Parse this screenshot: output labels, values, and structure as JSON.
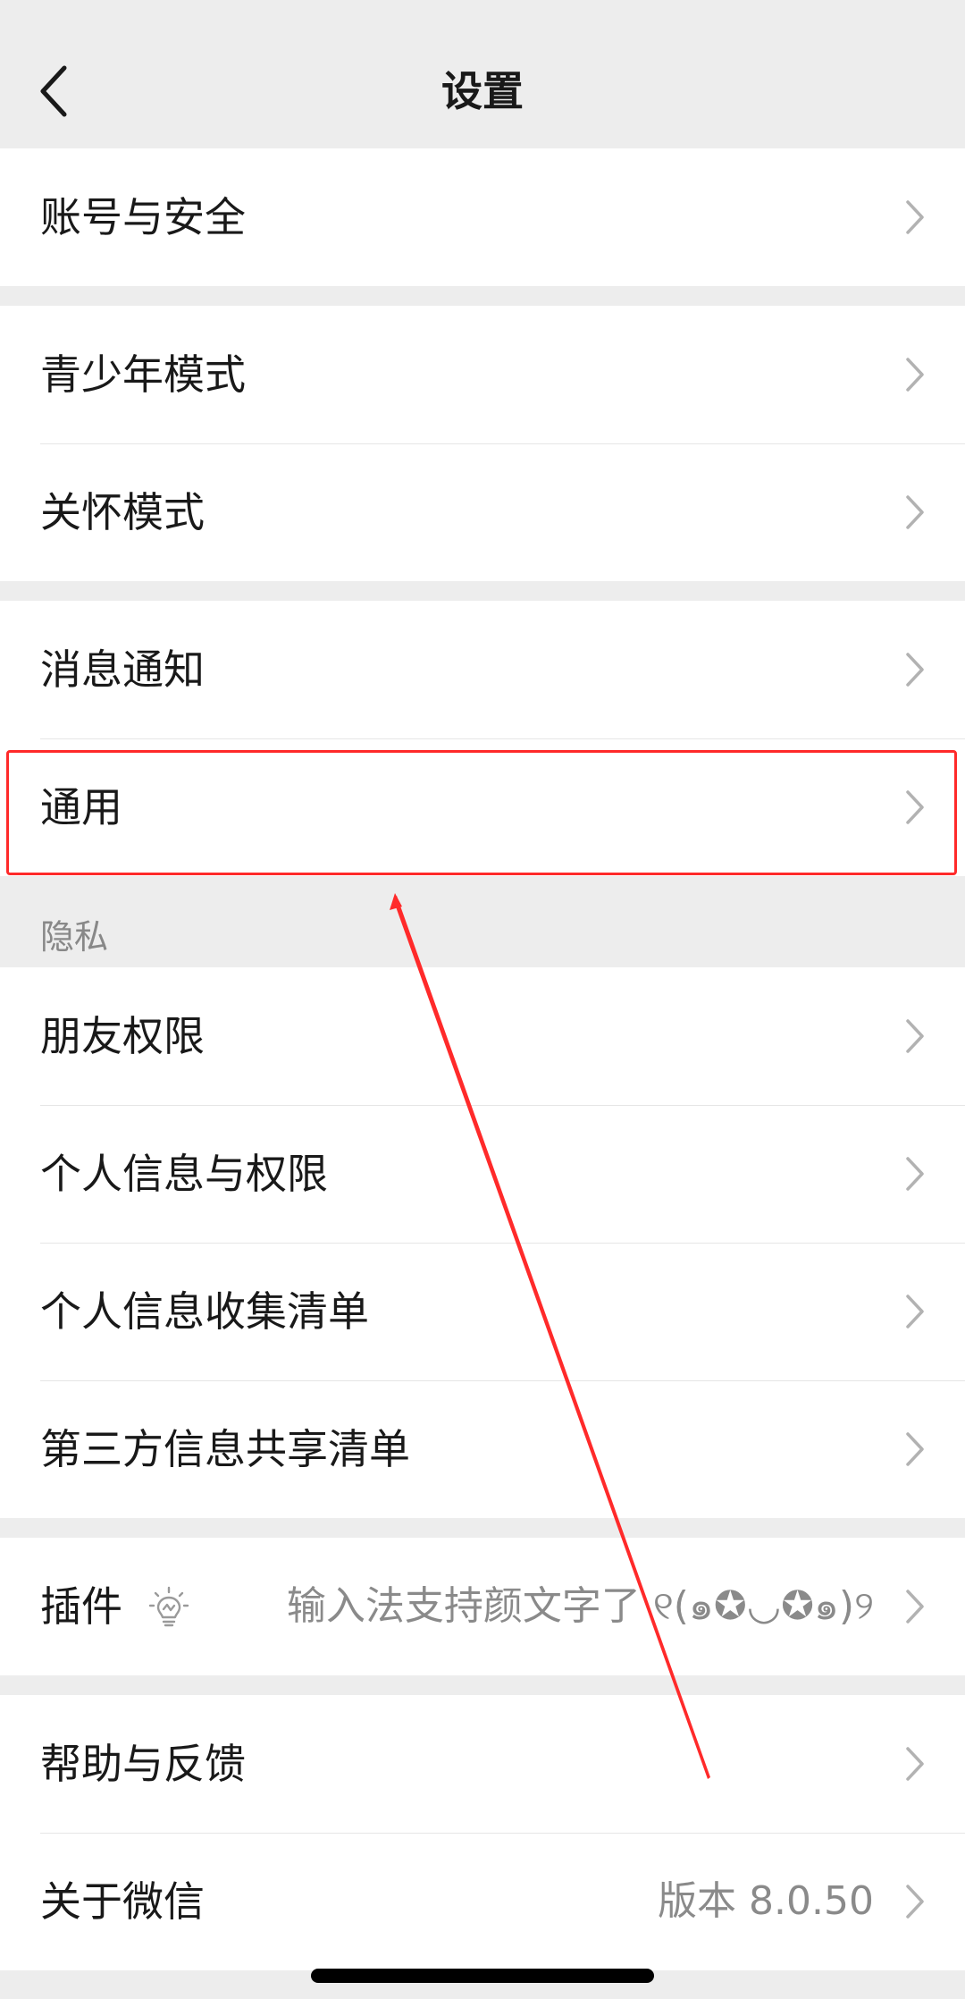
{
  "header": {
    "title": "设置",
    "back_icon": "chevron-left-icon"
  },
  "groups": [
    {
      "items": [
        {
          "label": "账号与安全"
        }
      ]
    },
    {
      "items": [
        {
          "label": "青少年模式"
        },
        {
          "label": "关怀模式"
        }
      ]
    },
    {
      "items": [
        {
          "label": "消息通知"
        },
        {
          "label": "通用"
        }
      ]
    },
    {
      "title": "隐私",
      "items": [
        {
          "label": "朋友权限"
        },
        {
          "label": "个人信息与权限"
        },
        {
          "label": "个人信息收集清单"
        },
        {
          "label": "第三方信息共享清单"
        }
      ]
    },
    {
      "items": [
        {
          "label": "插件",
          "icon": "lightbulb-icon",
          "value": "输入法支持颜文字了 ୧(๑✪◡✪๑)୨"
        }
      ]
    },
    {
      "items": [
        {
          "label": "帮助与反馈"
        },
        {
          "label": "关于微信",
          "value": "版本 8.0.50"
        }
      ]
    }
  ],
  "annotation": {
    "highlight_color": "#ff2a2a"
  },
  "colors": {
    "background": "#ededed",
    "row_background": "#ffffff",
    "text": "#191919",
    "secondary_text": "#8a8a8a"
  }
}
